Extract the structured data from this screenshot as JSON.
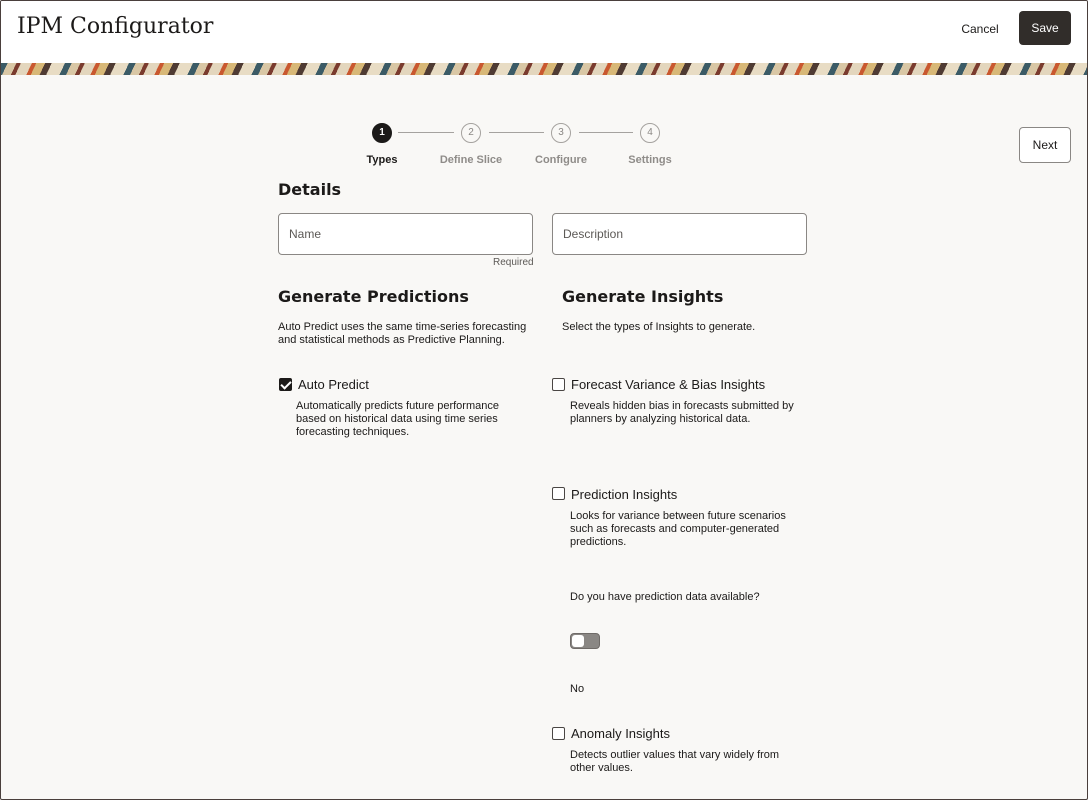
{
  "header": {
    "title": "IPM Configurator",
    "cancel_label": "Cancel",
    "save_label": "Save"
  },
  "stepper": {
    "steps": [
      {
        "number": "1",
        "label": "Types",
        "active": true
      },
      {
        "number": "2",
        "label": "Define Slice",
        "active": false
      },
      {
        "number": "3",
        "label": "Configure",
        "active": false
      },
      {
        "number": "4",
        "label": "Settings",
        "active": false
      }
    ],
    "next_label": "Next"
  },
  "details": {
    "title": "Details",
    "name_placeholder": "Name",
    "name_value": "",
    "name_helper": "Required",
    "description_placeholder": "Description",
    "description_value": ""
  },
  "predictions": {
    "title": "Generate Predictions",
    "intro": "Auto Predict uses the same time-series forecasting and statistical methods as Predictive Planning.",
    "options": [
      {
        "label": "Auto Predict",
        "checked": true,
        "description": "Automatically predicts future performance based on historical data using time series forecasting techniques."
      }
    ]
  },
  "insights": {
    "title": "Generate Insights",
    "intro": "Select the types of Insights to generate.",
    "forecast_variance": {
      "label": "Forecast Variance & Bias Insights",
      "checked": false,
      "description": "Reveals hidden bias in forecasts submitted by planners by analyzing historical data."
    },
    "prediction": {
      "label": "Prediction Insights",
      "checked": false,
      "description": "Looks for variance between future scenarios such as forecasts and computer-generated predictions.",
      "question": "Do you have prediction data available?",
      "toggle_on": false,
      "toggle_value_label": "No"
    },
    "anomaly": {
      "label": "Anomaly Insights",
      "checked": false,
      "description": "Detects outlier values that vary widely from other values."
    }
  },
  "colors": {
    "primary_button": "#312d2a",
    "page_background": "#f9f8f6",
    "text": "#1c1a19"
  }
}
